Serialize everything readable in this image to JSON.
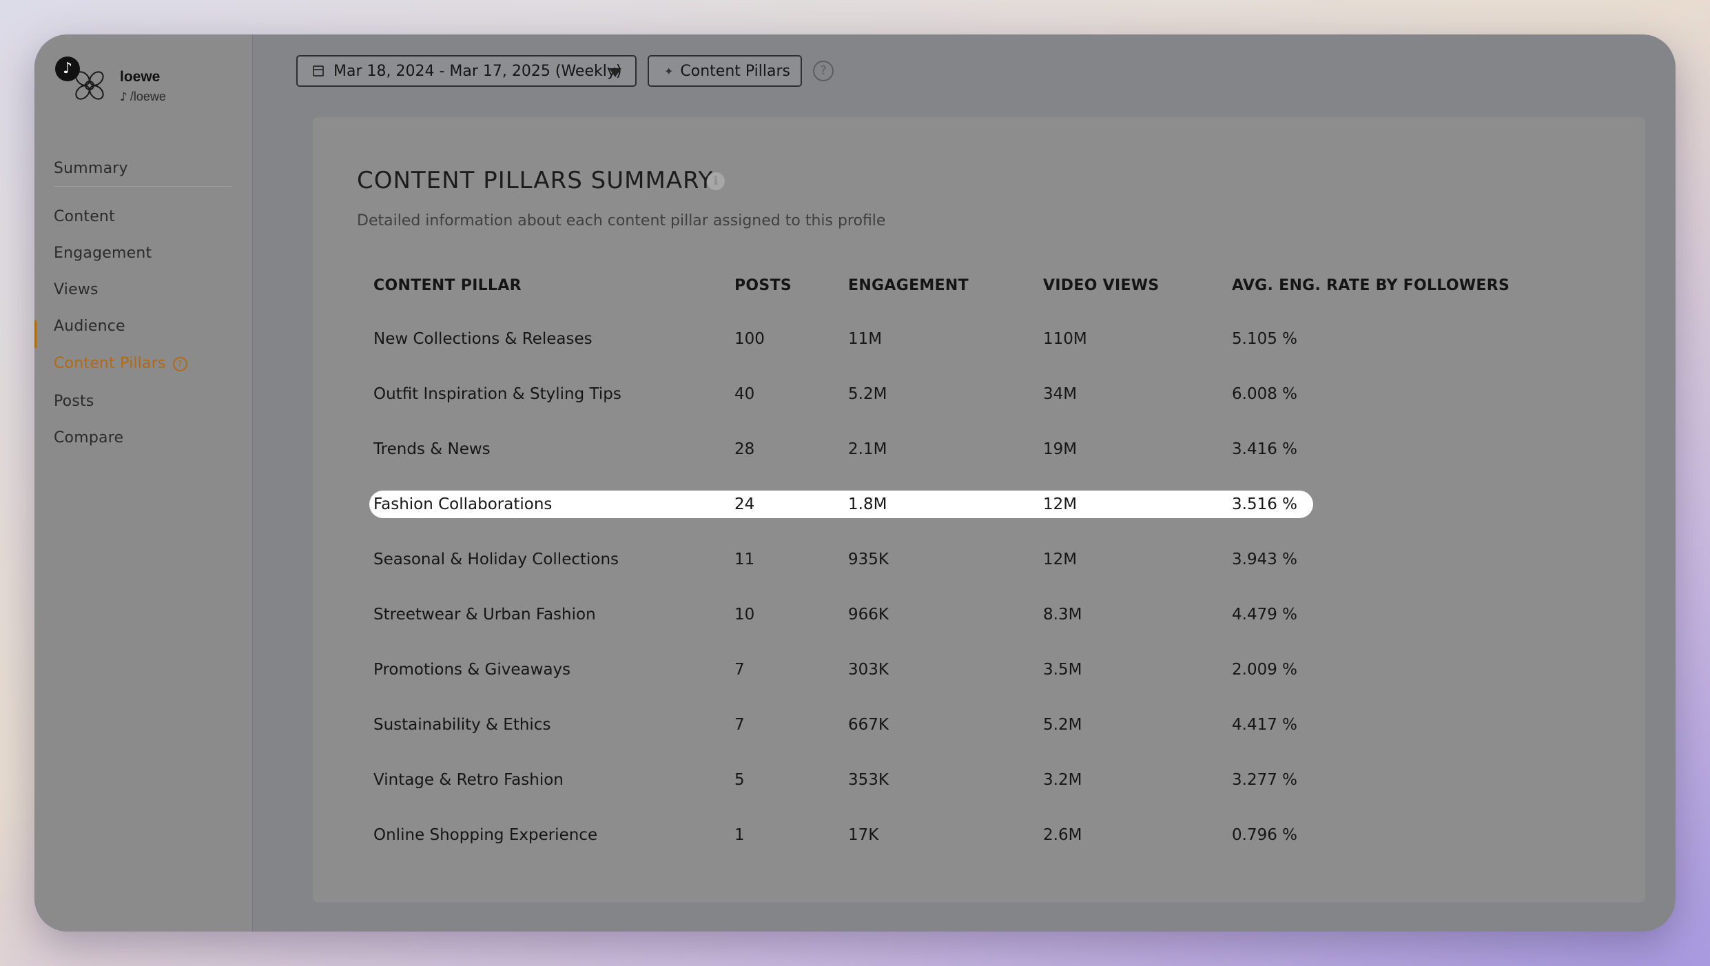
{
  "profile": {
    "name": "loewe",
    "handle": "/loewe",
    "platform_icon": "tiktok-icon",
    "logo_icon": "loewe-anagram-logo"
  },
  "sidebar": {
    "items": [
      {
        "label": "Summary"
      },
      {
        "label": "Content"
      },
      {
        "label": "Engagement"
      },
      {
        "label": "Views"
      },
      {
        "label": "Audience"
      },
      {
        "label": "Content Pillars",
        "active": true
      },
      {
        "label": "Posts"
      },
      {
        "label": "Compare"
      }
    ]
  },
  "toolbar": {
    "date_range": "Mar 18, 2024 - Mar 17, 2025 (Weekly)",
    "pillars_button": "Content Pillars",
    "help_glyph": "?"
  },
  "panel": {
    "title": "CONTENT PILLARS SUMMARY",
    "subtitle": "Detailed information about each content pillar assigned to this profile",
    "info_glyph": "i",
    "columns": [
      "CONTENT PILLAR",
      "POSTS",
      "ENGAGEMENT",
      "VIDEO VIEWS",
      "AVG. ENG. RATE BY FOLLOWERS"
    ],
    "rows": [
      [
        "New Collections & Releases",
        "100",
        "11M",
        "110M",
        "5.105 %"
      ],
      [
        "Outfit Inspiration & Styling Tips",
        "40",
        "5.2M",
        "34M",
        "6.008 %"
      ],
      [
        "Trends & News",
        "28",
        "2.1M",
        "19M",
        "3.416 %"
      ],
      [
        "Fashion Collaborations",
        "24",
        "1.8M",
        "12M",
        "3.516 %"
      ],
      [
        "Seasonal & Holiday Collections",
        "11",
        "935K",
        "12M",
        "3.943 %"
      ],
      [
        "Streetwear & Urban Fashion",
        "10",
        "966K",
        "8.3M",
        "4.479 %"
      ],
      [
        "Promotions & Giveaways",
        "7",
        "303K",
        "3.5M",
        "2.009 %"
      ],
      [
        "Sustainability & Ethics",
        "7",
        "667K",
        "5.2M",
        "4.417 %"
      ],
      [
        "Vintage & Retro Fashion",
        "5",
        "353K",
        "3.2M",
        "3.277 %"
      ],
      [
        "Online Shopping Experience",
        "1",
        "17K",
        "2.6M",
        "0.796 %"
      ]
    ],
    "highlighted_row": 3
  },
  "colors": {
    "accent": "#b26a14",
    "overlay": "#848589",
    "highlight": "#ffffff"
  }
}
